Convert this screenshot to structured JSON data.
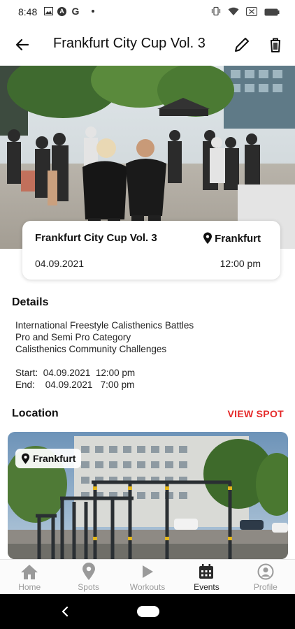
{
  "status_bar": {
    "time": "8:48",
    "left_icons": [
      "image-icon",
      "a-circle-icon",
      "g-icon",
      "dot-icon"
    ],
    "a_letter": "A",
    "g_letter": "G",
    "right_icons": [
      "vibrate-icon",
      "wifi-icon",
      "battery-saver-icon",
      "battery-icon"
    ]
  },
  "app_bar": {
    "title": "Frankfurt City Cup Vol. 3",
    "back_icon": "arrow-left-icon",
    "edit_icon": "pencil-icon",
    "delete_icon": "trash-icon"
  },
  "event": {
    "title": "Frankfurt City Cup Vol. 3",
    "location": "Frankfurt",
    "date": "04.09.2021",
    "time": "12:00 pm"
  },
  "details": {
    "heading": "Details",
    "lines": [
      "International Freestyle Calisthenics Battles",
      "Pro and Semi Pro Category",
      "Calisthenics Community Challenges",
      "",
      "Start:  04.09.2021  12:00 pm",
      "End:    04.09.2021   7:00 pm"
    ]
  },
  "location": {
    "heading": "Location",
    "view_spot_label": "VIEW SPOT",
    "chip_label": "Frankfurt"
  },
  "bottom_nav": {
    "items": [
      {
        "label": "Home",
        "icon": "home-icon"
      },
      {
        "label": "Spots",
        "icon": "map-pin-icon"
      },
      {
        "label": "Workouts",
        "icon": "play-icon"
      },
      {
        "label": "Events",
        "icon": "calendar-icon"
      },
      {
        "label": "Profile",
        "icon": "profile-icon"
      }
    ],
    "active": "Events"
  },
  "colors": {
    "accent": "#e52a2a",
    "nav_inactive": "#9a9a9a",
    "nav_active": "#222222"
  }
}
